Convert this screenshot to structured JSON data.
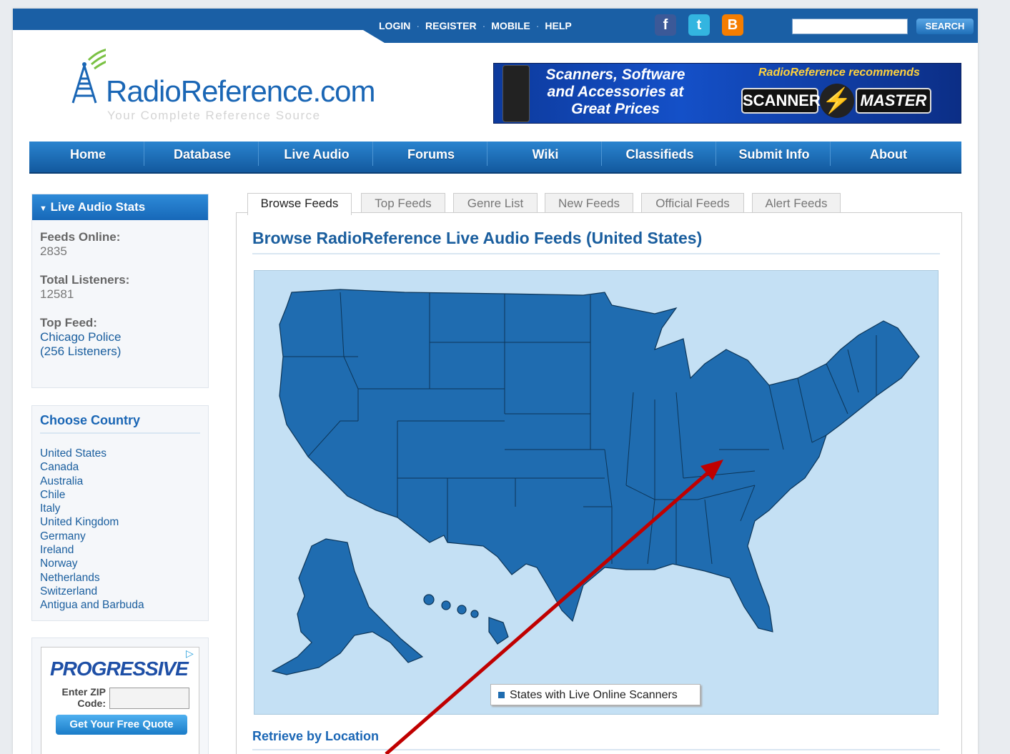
{
  "top_links": [
    "LOGIN",
    "REGISTER",
    "MOBILE",
    "HELP"
  ],
  "social": [
    {
      "name": "facebook-icon",
      "glyph": "f",
      "color": "#3b5998"
    },
    {
      "name": "twitter-icon",
      "glyph": "t",
      "color": "#33b5e0"
    },
    {
      "name": "blogger-icon",
      "glyph": "B",
      "color": "#f57d00"
    }
  ],
  "search": {
    "button": "SEARCH",
    "value": ""
  },
  "logo": {
    "name": "RadioReference.com",
    "tagline": "Your Complete Reference Source"
  },
  "banner": {
    "headline": "Scanners, Software and Accessories at Great Prices",
    "recommends": "RadioReference recommends",
    "brand_left": "SCANNER",
    "brand_right": "MASTER"
  },
  "nav": [
    "Home",
    "Database",
    "Live Audio",
    "Forums",
    "Wiki",
    "Classifieds",
    "Submit Info",
    "About"
  ],
  "stats": {
    "header": "Live Audio Stats",
    "feeds_online_label": "Feeds Online:",
    "feeds_online": "2835",
    "listeners_label": "Total Listeners:",
    "listeners": "12581",
    "top_feed_label": "Top Feed:",
    "top_feed": "Chicago Police",
    "top_feed_listeners": "(256 Listeners)"
  },
  "countries": {
    "title": "Choose Country",
    "items": [
      "United States",
      "Canada",
      "Australia",
      "Chile",
      "Italy",
      "United Kingdom",
      "Germany",
      "Ireland",
      "Norway",
      "Netherlands",
      "Switzerland",
      "Antigua and Barbuda"
    ]
  },
  "ad": {
    "brand": "PROGRESSIVE",
    "zip_label": "Enter ZIP Code:",
    "button": "Get Your Free Quote"
  },
  "tabs": [
    "Browse Feeds",
    "Top Feeds",
    "Genre List",
    "New Feeds",
    "Official Feeds",
    "Alert Feeds"
  ],
  "content": {
    "title": "Browse RadioReference Live Audio Feeds (United States)",
    "legend": "States with Live Online Scanners",
    "retrieve": "Retrieve by Location"
  },
  "colors": {
    "state_fill": "#1f6cb0",
    "map_bg": "#c4e0f4",
    "arrow": "#c00000",
    "brand_blue": "#1a66b5"
  }
}
